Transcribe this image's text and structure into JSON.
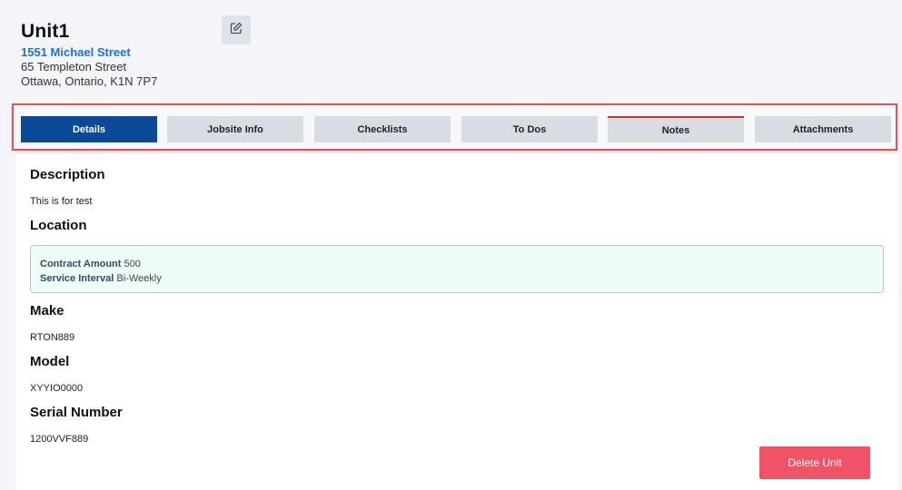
{
  "header": {
    "title": "Unit1",
    "street": "1551 Michael Street",
    "address_line1": "65 Templeton Street",
    "address_line2": "Ottawa, Ontario, K1N 7P7",
    "edit_icon": "edit-icon"
  },
  "tabs": [
    {
      "label": "Details",
      "active": true
    },
    {
      "label": "Jobsite Info",
      "active": false
    },
    {
      "label": "Checklists",
      "active": false
    },
    {
      "label": "To Dos",
      "active": false
    },
    {
      "label": "Notes",
      "active": false
    },
    {
      "label": "Attachments",
      "active": false
    }
  ],
  "details": {
    "description_title": "Description",
    "description_value": "This is for test",
    "location_title": "Location",
    "contract_amount_label": "Contract Amount",
    "contract_amount_value": "500",
    "service_interval_label": "Service Interval",
    "service_interval_value": "Bi-Weekly",
    "make_title": "Make",
    "make_value": "RTON889",
    "model_title": "Model",
    "model_value": "XYYIO0000",
    "serial_title": "Serial Number",
    "serial_value": "1200VVF889"
  },
  "actions": {
    "delete_label": "Delete Unit"
  },
  "colors": {
    "active_tab": "#0b4a98",
    "link": "#1f6fd8",
    "delete": "#f05267",
    "highlight_border": "#e45252"
  }
}
